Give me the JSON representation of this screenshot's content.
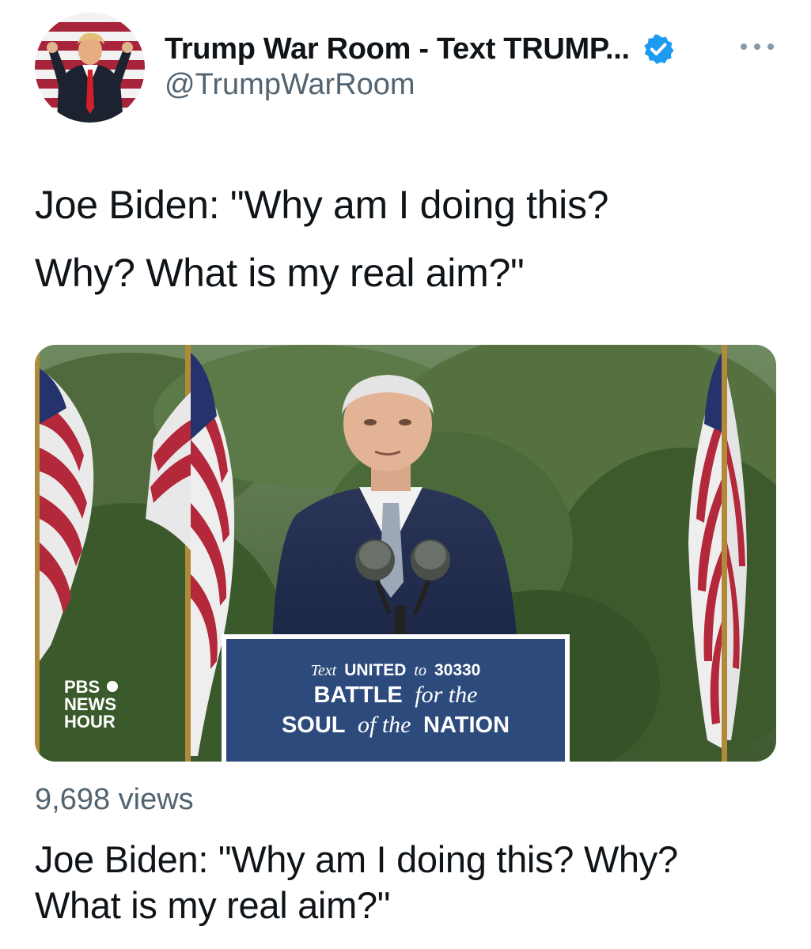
{
  "tweet": {
    "display_name": "Trump War Room - Text TRUMP...",
    "handle": "@TrumpWarRoom",
    "verified": true,
    "text_lines": [
      "Joe Biden: \"Why am I doing this?",
      "Why? What is my real aim?\""
    ],
    "views": "9,698 views",
    "card_text_lines": [
      "Joe Biden: \"Why am I doing this? Why?",
      "What is my real aim?\""
    ]
  },
  "video": {
    "podium_line1_small": "Text",
    "podium_line1_big": "UNITED",
    "podium_line1_small2": "to",
    "podium_line1_number": "30330",
    "podium_line2_big": "BATTLE",
    "podium_line2_small": "for the",
    "podium_line3_big1": "SOUL",
    "podium_line3_small": "of the",
    "podium_line3_big2": "NATION",
    "logo_lines": [
      "PBS",
      "NEWS",
      "HOUR"
    ]
  },
  "colors": {
    "verified_blue": "#1d9bf0",
    "secondary_text": "#536471",
    "podium_blue": "#2d4a7c"
  },
  "icons": [
    "verified-badge-icon",
    "more-options-icon"
  ]
}
